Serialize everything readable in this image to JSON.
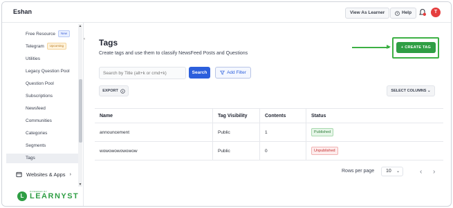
{
  "header": {
    "brand": "Eshan",
    "view_as_learner": "View As Learner",
    "help": "Help",
    "avatar_initial": "T"
  },
  "sidebar": {
    "items": [
      {
        "label": "Free Resource",
        "badge": "New"
      },
      {
        "label": "Telegram",
        "badge": "Upcoming"
      },
      {
        "label": "Utilities"
      },
      {
        "label": "Legacy Question Pool"
      },
      {
        "label": "Question Pool"
      },
      {
        "label": "Subscriptions"
      },
      {
        "label": "Newsfeed"
      },
      {
        "label": "Communities"
      },
      {
        "label": "Categories"
      },
      {
        "label": "Segments"
      },
      {
        "label": "Tags"
      }
    ],
    "websites_apps": "Websites & Apps",
    "powered_by": "POWERED BY",
    "logo_text": "LEARNYST",
    "logo_letter": "L"
  },
  "main": {
    "title": "Tags",
    "subtitle": "Create tags and use them to classify NewsFeed Posts and Questions",
    "create_tag": "CREATE TAG",
    "search_placeholder": "Search by Title (alt+k or cmd+k)",
    "search_label": "Search",
    "add_filter": "Add Filter",
    "export": "EXPORT",
    "select_columns": "SELECT COLUMNS"
  },
  "table": {
    "columns": [
      "Name",
      "Tag Visibility",
      "Contents",
      "Status"
    ],
    "rows": [
      {
        "name": "announcement",
        "visibility": "Public",
        "contents": "1",
        "status": "Published"
      },
      {
        "name": "wowowowowowow",
        "visibility": "Public",
        "contents": "0",
        "status": "Unpublished"
      }
    ]
  },
  "pagination": {
    "rows_per_page_label": "Rows per page",
    "rows_per_page_value": "10"
  },
  "colors": {
    "accent_green": "#2f9e44",
    "primary_blue": "#2c5fdc",
    "avatar_red": "#e53e3e"
  }
}
